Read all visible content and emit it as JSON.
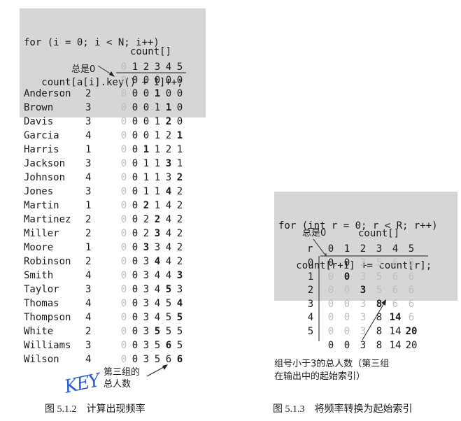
{
  "left": {
    "code": [
      "for (i = 0; i < N; i++)",
      "   count[a[i].key() + 1]++;"
    ],
    "array_label": "count[]",
    "index_header": [
      "0",
      "1",
      "2",
      "3",
      "4",
      "5"
    ],
    "zero_label": "总是0",
    "initial_row": [
      "0",
      "0",
      "0",
      "0",
      "0",
      "0"
    ],
    "rows": [
      {
        "name": "Anderson",
        "key": "2",
        "counts": [
          "0",
          "0",
          "0",
          "1",
          "0",
          "0"
        ],
        "bold": 3
      },
      {
        "name": "Brown",
        "key": "3",
        "counts": [
          "0",
          "0",
          "0",
          "1",
          "1",
          "0"
        ],
        "bold": 4
      },
      {
        "name": "Davis",
        "key": "3",
        "counts": [
          "0",
          "0",
          "0",
          "1",
          "2",
          "0"
        ],
        "bold": 4
      },
      {
        "name": "Garcia",
        "key": "4",
        "counts": [
          "0",
          "0",
          "0",
          "1",
          "2",
          "1"
        ],
        "bold": 5
      },
      {
        "name": "Harris",
        "key": "1",
        "counts": [
          "0",
          "0",
          "1",
          "1",
          "2",
          "1"
        ],
        "bold": 2
      },
      {
        "name": "Jackson",
        "key": "3",
        "counts": [
          "0",
          "0",
          "1",
          "1",
          "3",
          "1"
        ],
        "bold": 4
      },
      {
        "name": "Johnson",
        "key": "4",
        "counts": [
          "0",
          "0",
          "1",
          "1",
          "3",
          "2"
        ],
        "bold": 5
      },
      {
        "name": "Jones",
        "key": "3",
        "counts": [
          "0",
          "0",
          "1",
          "1",
          "4",
          "2"
        ],
        "bold": 4
      },
      {
        "name": "Martin",
        "key": "1",
        "counts": [
          "0",
          "0",
          "2",
          "1",
          "4",
          "2"
        ],
        "bold": 2
      },
      {
        "name": "Martinez",
        "key": "2",
        "counts": [
          "0",
          "0",
          "2",
          "2",
          "4",
          "2"
        ],
        "bold": 3
      },
      {
        "name": "Miller",
        "key": "2",
        "counts": [
          "0",
          "0",
          "2",
          "3",
          "4",
          "2"
        ],
        "bold": 3
      },
      {
        "name": "Moore",
        "key": "1",
        "counts": [
          "0",
          "0",
          "3",
          "3",
          "4",
          "2"
        ],
        "bold": 2
      },
      {
        "name": "Robinson",
        "key": "2",
        "counts": [
          "0",
          "0",
          "3",
          "4",
          "4",
          "2"
        ],
        "bold": 3
      },
      {
        "name": "Smith",
        "key": "4",
        "counts": [
          "0",
          "0",
          "3",
          "4",
          "4",
          "3"
        ],
        "bold": 5
      },
      {
        "name": "Taylor",
        "key": "3",
        "counts": [
          "0",
          "0",
          "3",
          "4",
          "5",
          "3"
        ],
        "bold": 4
      },
      {
        "name": "Thomas",
        "key": "4",
        "counts": [
          "0",
          "0",
          "3",
          "4",
          "5",
          "4"
        ],
        "bold": 5
      },
      {
        "name": "Thompson",
        "key": "4",
        "counts": [
          "0",
          "0",
          "3",
          "4",
          "5",
          "5"
        ],
        "bold": 5
      },
      {
        "name": "White",
        "key": "2",
        "counts": [
          "0",
          "0",
          "3",
          "5",
          "5",
          "5"
        ],
        "bold": 3
      },
      {
        "name": "Williams",
        "key": "3",
        "counts": [
          "0",
          "0",
          "3",
          "5",
          "6",
          "5"
        ],
        "bold": 4
      },
      {
        "name": "Wilson",
        "key": "4",
        "counts": [
          "0",
          "0",
          "3",
          "5",
          "6",
          "6"
        ],
        "bold": 5
      }
    ],
    "annotation": [
      "第三组的",
      "总人数"
    ],
    "handwriting": "KEY",
    "caption": "图 5.1.2　计算出现频率"
  },
  "right": {
    "code": [
      "for (int r = 0; r < R; r++)",
      "   count[r+1] += count[r];"
    ],
    "zero_label": "总是0",
    "array_label": "count[]",
    "r_label": "r",
    "index_header": [
      "0",
      "1",
      "2",
      "3",
      "4",
      "5"
    ],
    "rows": [
      {
        "r": "0",
        "counts": [
          "0",
          "0",
          "3",
          "5",
          "6",
          "6"
        ],
        "bold": -1
      },
      {
        "r": "1",
        "counts": [
          "0",
          "0",
          "3",
          "5",
          "6",
          "6"
        ],
        "bold": 1
      },
      {
        "r": "2",
        "counts": [
          "0",
          "0",
          "3",
          "5",
          "6",
          "6"
        ],
        "bold": 2
      },
      {
        "r": "3",
        "counts": [
          "0",
          "0",
          "3",
          "8",
          "6",
          "6"
        ],
        "bold": 3
      },
      {
        "r": "4",
        "counts": [
          "0",
          "0",
          "3",
          "8",
          "14",
          "6"
        ],
        "bold": 4
      },
      {
        "r": "5",
        "counts": [
          "0",
          "0",
          "3",
          "8",
          "14",
          "20"
        ],
        "bold": 5
      }
    ],
    "final_row": [
      "0",
      "0",
      "3",
      "8",
      "14",
      "20"
    ],
    "annotation": [
      "组号小于3的总人数（第三组",
      "在输出中的起始索引）"
    ],
    "caption": "图 5.1.3　将频率转换为起始索引"
  }
}
